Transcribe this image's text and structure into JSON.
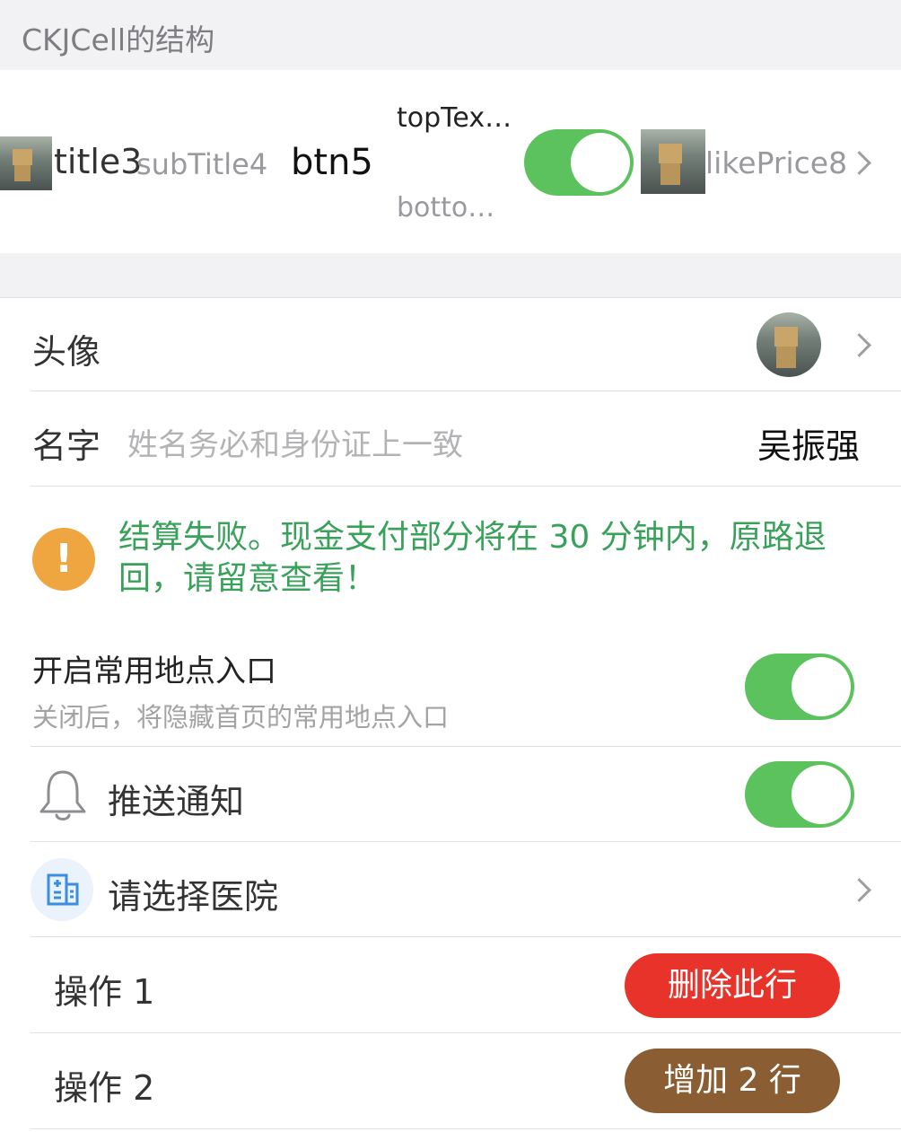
{
  "section": {
    "title": "CKJCell的结构"
  },
  "structure_cell": {
    "title": "title3",
    "subtitle": "subTitle4",
    "button": "btn5",
    "top_text": "topTex…",
    "bottom_text": "botto…",
    "toggle_on": true,
    "like_price": "likePrice8",
    "thumbnail_icon": "photo-thumbnail",
    "chevron_icon": "chevron-right"
  },
  "avatar_row": {
    "label": "头像",
    "avatar_icon": "avatar-photo",
    "chevron_icon": "chevron-right"
  },
  "name_row": {
    "label": "名字",
    "placeholder": "姓名务必和身份证上一致",
    "value": "吴振强"
  },
  "alert_row": {
    "icon": "exclamation-icon",
    "icon_glyph": "!",
    "message": "结算失败。现金支付部分将在 30 分钟内，原路退回，请留意查看！",
    "text_color": "#3aa15b",
    "icon_color": "#f0a640"
  },
  "frequent_places_row": {
    "title": "开启常用地点入口",
    "subtitle": "关闭后，将隐藏首页的常用地点入口",
    "toggle_on": true
  },
  "push_row": {
    "label": "推送通知",
    "icon": "bell-icon",
    "toggle_on": true
  },
  "hospital_row": {
    "label": "请选择医院",
    "icon": "hospital-building-icon",
    "chevron_icon": "chevron-right"
  },
  "action_rows": [
    {
      "label": "操作 1",
      "button": "删除此行",
      "button_color": "#e8332a"
    },
    {
      "label": "操作 2",
      "button": "增加 2 行",
      "button_color": "#8a5d33"
    }
  ],
  "colors": {
    "toggle_on": "#5cc25e",
    "accent_green_text": "#3aa15b"
  }
}
